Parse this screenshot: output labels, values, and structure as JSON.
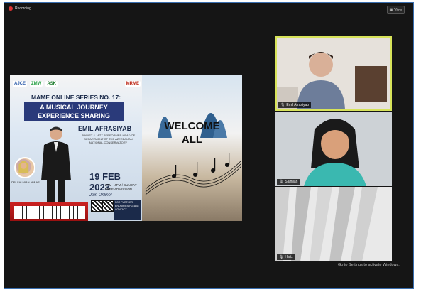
{
  "topbar": {
    "recording_label": "Recording",
    "view_label": "View"
  },
  "poster": {
    "logos": [
      "AJCE",
      "ZMW",
      "ASK",
      "MRME"
    ],
    "series_title": "MAME ONLINE SERIES NO. 17:",
    "subtitle": "A MUSICAL JOURNEY EXPERIENCE SHARING",
    "performer": "EMIL AFRASIYAB",
    "performer_desc": "PIANIST & JAZZ PERFORMER HEAD OF DEPARTMENT OF THE AZERBAIJAN NATIONAL CONSERVATORY",
    "speaker_name": "DR. SALMIAH ABBAS",
    "date": "19 FEB 2023",
    "time": "2PM - 4PM / SUNDAY FREE ADMISSION",
    "join": "Join Online!",
    "info": "FOR FURTHER ENQUIRIES PLEASE CONTACT"
  },
  "welcome": {
    "line1": "WELCOME",
    "line2": "ALL"
  },
  "participants": [
    {
      "name": "Emil Afrasiyab"
    },
    {
      "name": "Salmiah"
    },
    {
      "name": "Hafiz"
    }
  ],
  "activate_windows": "Go to Settings to activate Windows.",
  "colors": {
    "active_speaker_border": "#d7e35a",
    "background": "#151515",
    "recording_dot": "#dd3333"
  }
}
